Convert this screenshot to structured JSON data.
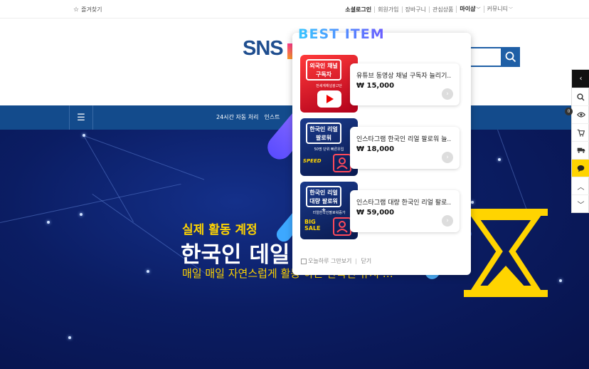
{
  "topbar": {
    "bookmark": "즐겨찾기",
    "menu": [
      "소셜로그인",
      "회원가입",
      "장바구니",
      "관심상품",
      "마이샵",
      "커뮤니티"
    ]
  },
  "header": {
    "logo": "SNS",
    "search_icon": "search-icon"
  },
  "nav": {
    "menu_icon": "hamburger-icon",
    "links": [
      "24시간 자동 처리",
      "인스트"
    ]
  },
  "hero": {
    "line1": "실제 활동 계정",
    "line2": "한국인 데일",
    "line3": "매일 매일 자연스럽게 활동 하는 한국인 유저 …"
  },
  "popup": {
    "title": "BEST ITEM",
    "items": [
      {
        "thumb_title": "외국인 채널\n구독자",
        "thumb_sub": "전세계채널광고단",
        "name": "유튜브 동영상 채널 구독자 늘리기..",
        "price": "₩ 15,000"
      },
      {
        "thumb_title": "한국인 리얼\n팔로워",
        "thumb_sub": "50명 단위 빠른유입",
        "name": "인스타그램 한국인 리얼 팔로워 늘..",
        "price": "₩ 18,000"
      },
      {
        "thumb_title": "한국인 리얼\n대량 팔로워+",
        "thumb_sub": "리얼한국인팔로워증가",
        "name": "인스타그램 대량 한국인 리얼 팔로..",
        "price": "₩ 59,000"
      }
    ],
    "footer": {
      "hide_today": "오늘하루 그만보기",
      "close": "닫기"
    }
  },
  "quickbar": {
    "badge": "0",
    "icons": [
      "chevron-left-icon",
      "search-icon",
      "eye-icon",
      "cart-icon",
      "truck-icon",
      "chat-icon",
      "chevron-up-icon",
      "chevron-down-icon"
    ]
  },
  "colors": {
    "brand": "#1f5fa6",
    "nav": "#134b8c",
    "accent_yellow": "#ffd400",
    "hero_dark": "#07124a"
  }
}
